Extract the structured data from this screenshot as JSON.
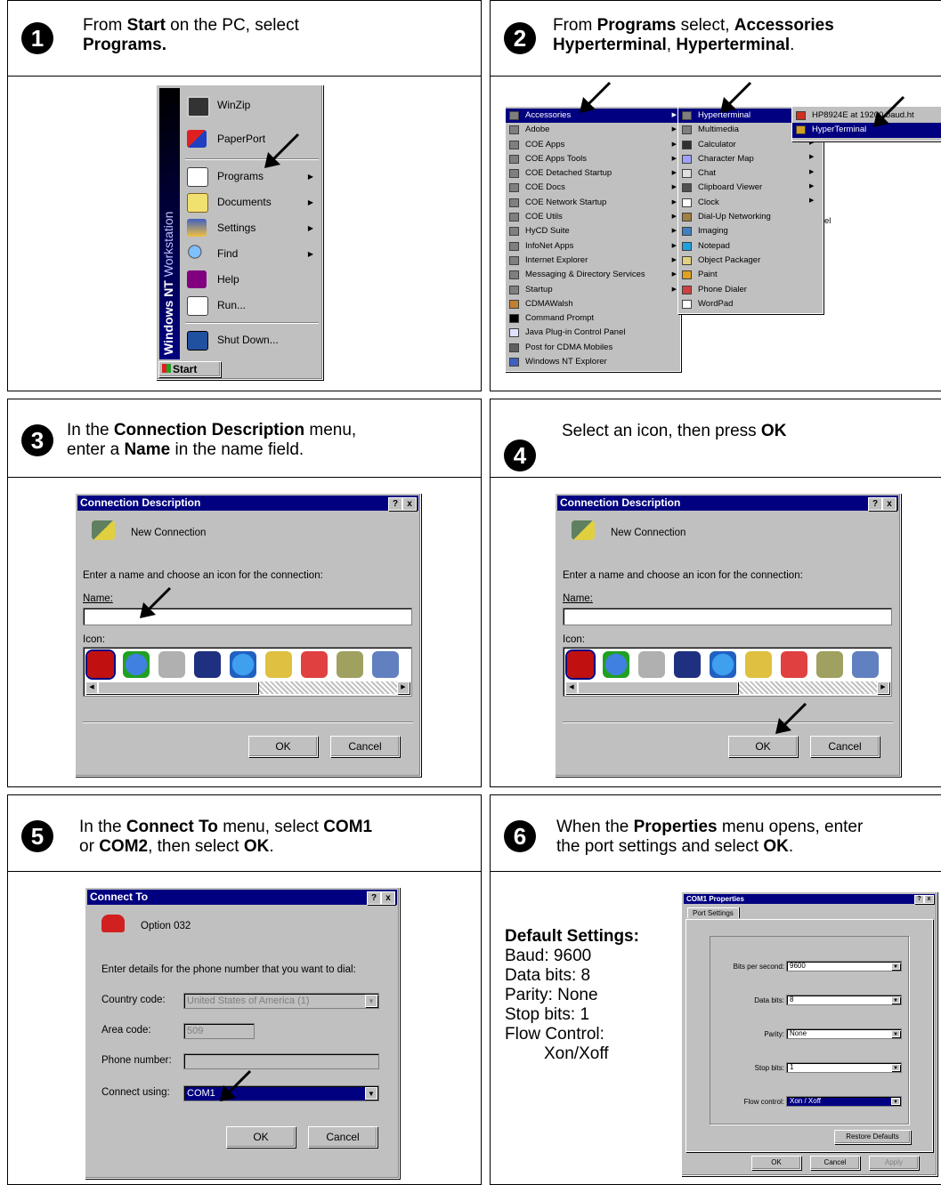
{
  "steps": [
    {
      "num": "1",
      "pre": "From ",
      "b1": "Start",
      "mid": " on the PC, select",
      "b2": "Programs."
    },
    {
      "num": "2",
      "pre": "From ",
      "b1": "Programs",
      "mid": " select, ",
      "b2": "Accessories",
      "line2a": "Hyperterminal",
      "line2sep": ", ",
      "line2b": "Hyperterminal",
      "line2end": "."
    },
    {
      "num": "3",
      "pre": "In the ",
      "b1": "Connection Description",
      "mid": " menu,",
      "line2pre": "enter a ",
      "b2": "Name",
      "line2end": " in the name field."
    },
    {
      "num": "4",
      "pre": "Select an icon, then press ",
      "b1": "OK"
    },
    {
      "num": "5",
      "pre": "In the ",
      "b1": "Connect To",
      "mid": " menu, select ",
      "b2": "COM1",
      "line2pre": "or ",
      "b3": "COM2",
      "line2mid": ", then select ",
      "b4": "OK",
      "line2end": "."
    },
    {
      "num": "6",
      "pre": "When the ",
      "b1": "Properties",
      "mid": " menu opens, enter",
      "line2pre": "the port settings and select ",
      "b2": "OK",
      "line2end": "."
    }
  ],
  "start_menu": {
    "banner": "Windows NT Workstation",
    "banner_bold": "Windows NT",
    "banner_rest": " Workstation",
    "items": [
      "WinZip",
      "PaperPort",
      "Programs",
      "Documents",
      "Settings",
      "Find",
      "Help",
      "Run...",
      "Shut Down..."
    ],
    "start_button": "Start"
  },
  "programs_menu": {
    "col1": [
      "Accessories",
      "Adobe",
      "COE Apps",
      "COE Apps Tools",
      "COE Detached Startup",
      "COE Docs",
      "COE Network Startup",
      "COE Utils",
      "HyCD Suite",
      "InfoNet Apps",
      "Internet Explorer",
      "Messaging & Directory Services",
      "Startup",
      "CDMAWalsh",
      "Command Prompt",
      "Java Plug-in Control Panel",
      "Post for CDMA Mobiles",
      "Windows NT Explorer"
    ],
    "col2": [
      "Hyperterminal",
      "Multimedia",
      "Calculator",
      "Character Map",
      "Chat",
      "Clipboard Viewer",
      "Clock",
      "Dial-Up Networking",
      "Imaging",
      "Notepad",
      "Object Packager",
      "Paint",
      "Phone Dialer",
      "WordPad"
    ],
    "col2_overflow": "el",
    "col3": [
      "HP8924E at 19200 baud.ht",
      "HyperTerminal"
    ]
  },
  "connection_description": {
    "title": "Connection Description",
    "help": "?",
    "close": "x",
    "subtitle": "New Connection",
    "prompt": "Enter a name and choose an icon for the connection:",
    "name_label": "Name:",
    "name_value": "",
    "icon_label": "Icon:",
    "ok": "OK",
    "cancel": "Cancel"
  },
  "connect_to": {
    "title": "Connect To",
    "help": "?",
    "close": "x",
    "subtitle": "Option 032",
    "prompt": "Enter details for the phone number that you want to dial:",
    "country_label": "Country code:",
    "country_value": "United States of America (1)",
    "area_label": "Area code:",
    "area_value": "509",
    "phone_label": "Phone number:",
    "phone_value": "",
    "connect_label": "Connect using:",
    "connect_value": "COM1",
    "ok": "OK",
    "cancel": "Cancel"
  },
  "default_settings": {
    "heading": "Default Settings:",
    "lines": [
      "Baud: 9600",
      "Data bits: 8",
      "Parity: None",
      "Stop bits: 1",
      "Flow Control:",
      "Xon/Xoff"
    ]
  },
  "com1_properties": {
    "title": "COM1 Properties",
    "help": "?",
    "close": "x",
    "tab": "Port Settings",
    "bits_label": "Bits per second:",
    "bits_value": "9600",
    "data_label": "Data bits:",
    "data_value": "8",
    "parity_label": "Parity:",
    "parity_value": "None",
    "stop_label": "Stop bits:",
    "stop_value": "1",
    "flow_label": "Flow control:",
    "flow_value": "Xon / Xoff",
    "restore": "Restore Defaults",
    "ok": "OK",
    "cancel": "Cancel",
    "apply": "Apply"
  }
}
